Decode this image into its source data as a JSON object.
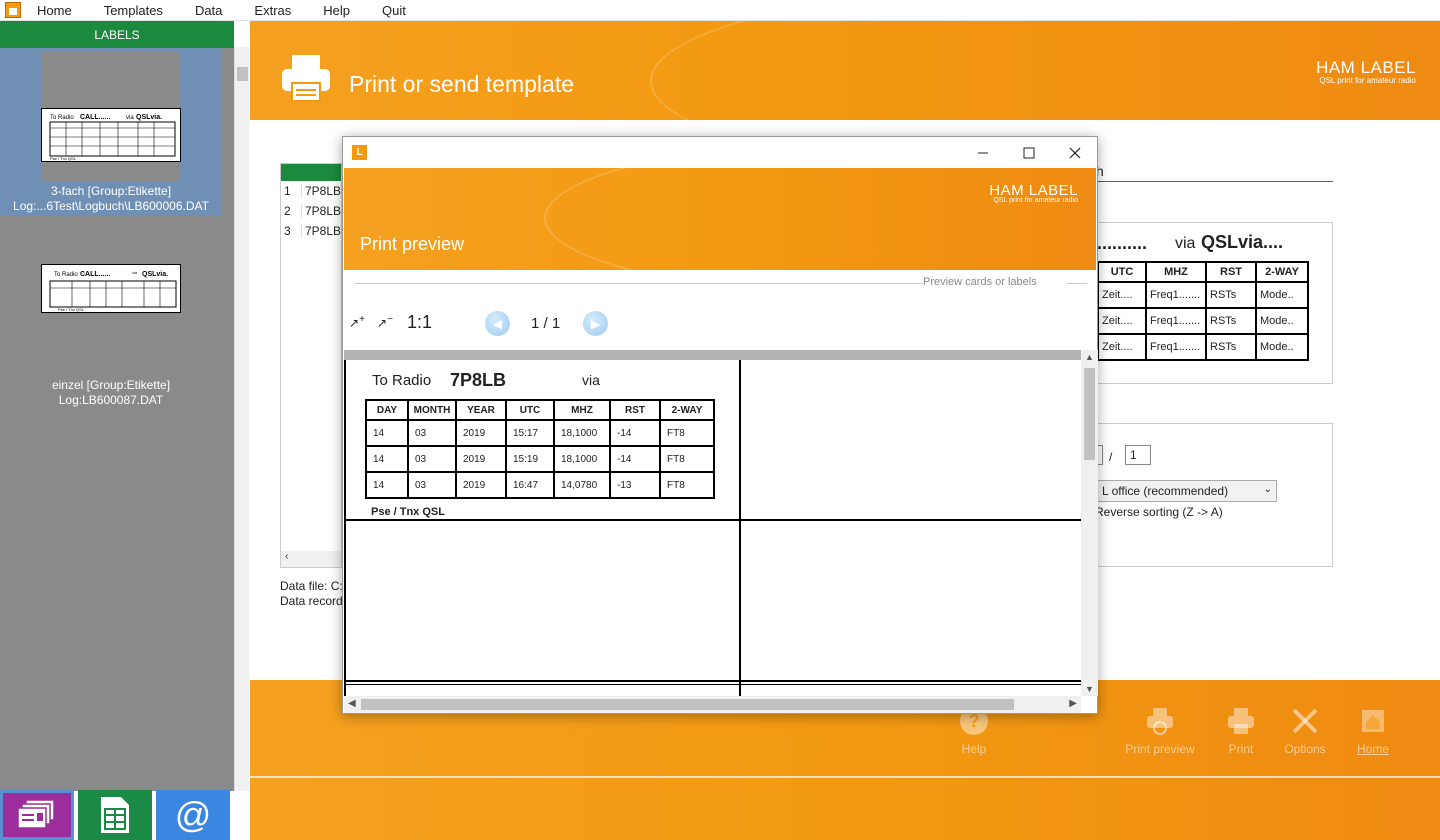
{
  "menu": {
    "items": [
      {
        "label": "Home"
      },
      {
        "label": "Templates"
      },
      {
        "label": "Data"
      },
      {
        "label": "Extras"
      },
      {
        "label": "Help"
      },
      {
        "label": "Quit"
      }
    ]
  },
  "sidebar": {
    "header": "LABELS",
    "templates": [
      {
        "caption_line1": "3-fach [Group:Etikette]",
        "caption_line2": "Log:...6Test\\Logbuch\\LB600006.DAT",
        "selected": true
      },
      {
        "caption_line1": "einzel [Group:Etikette]",
        "caption_line2": "Log:LB600087.DAT",
        "selected": false
      }
    ]
  },
  "header": {
    "title": "Print or send template",
    "brand_name": "HAM LABEL",
    "brand_tagline": "QSL print for amateur radio"
  },
  "records": {
    "rows": [
      {
        "num": "1",
        "call": "7P8LB"
      },
      {
        "num": "2",
        "call": "7P8LB"
      },
      {
        "num": "3",
        "call": "7P8LB"
      }
    ],
    "data_file_label": "Data file: C:",
    "data_records_label": "Data record"
  },
  "search_partial": "h",
  "bg_preview": {
    "dots": "..........",
    "via": "via",
    "qslvia": "QSLvia....",
    "headers": [
      "UTC",
      "MHZ",
      "RST",
      "2-WAY"
    ],
    "rows": [
      [
        "Zeit....",
        "Freq1.......",
        "RSTs",
        "Mode.."
      ],
      [
        "Zeit....",
        "Freq1.......",
        "RSTs",
        "Mode.."
      ],
      [
        "Zeit....",
        "Freq1.......",
        "RSTs",
        "Mode.."
      ]
    ]
  },
  "options": {
    "separator": "/",
    "copies": "1",
    "print_mode": "L office (recommended)",
    "reverse_label": "Reverse sorting (Z -> A)"
  },
  "actions": {
    "help": "Help",
    "print_preview": "Print preview",
    "print": "Print",
    "options": "Options",
    "home": "Home"
  },
  "dialog": {
    "icon_letter": "L",
    "title": "Print preview",
    "subtitle": "Preview cards or labels",
    "zoom_in": "+",
    "zoom_out": "−",
    "zoom_reset": "1:1",
    "page_indicator": "1 / 1"
  },
  "card": {
    "to_radio": "To Radio",
    "callsign": "7P8LB",
    "via": "via",
    "headers": [
      "DAY",
      "MONTH",
      "YEAR",
      "UTC",
      "MHZ",
      "RST",
      "2-WAY"
    ],
    "rows": [
      [
        "14",
        "03",
        "2019",
        "15:17",
        "18,1000",
        "-14",
        "FT8"
      ],
      [
        "14",
        "03",
        "2019",
        "15:19",
        "18,1000",
        "-14",
        "FT8"
      ],
      [
        "14",
        "03",
        "2019",
        "16:47",
        "14,0780",
        "-13",
        "FT8"
      ]
    ],
    "footer": "Pse / Tnx  QSL"
  },
  "colors": {
    "accent_orange": "#f39a12",
    "labels_green": "#1c8a3e",
    "selected_blue": "#6f90b4",
    "tile_purple": "#9b2e9c",
    "tile_green": "#1a8a46",
    "tile_blue": "#3a86e0"
  }
}
